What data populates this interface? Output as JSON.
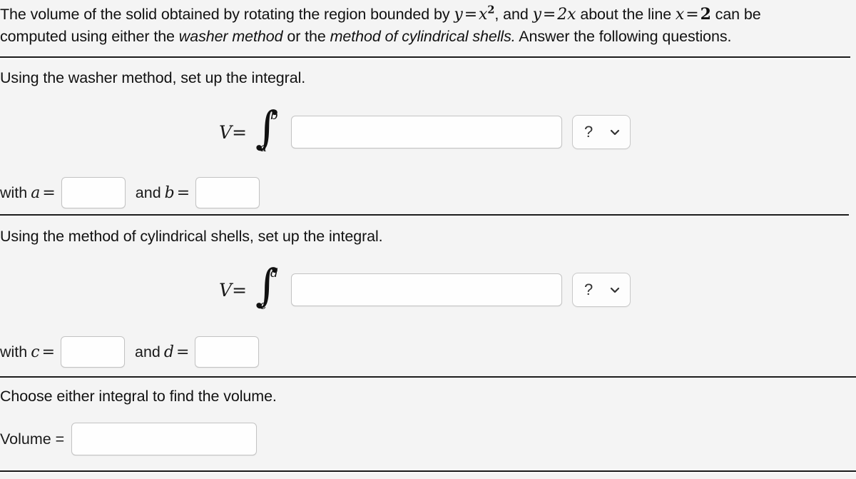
{
  "problem": {
    "line1_pre": "The volume of the solid obtained by rotating the region bounded by ",
    "eq1_lhs": "y",
    "eq1_rel": "=",
    "eq1_rhs_base": "x",
    "eq1_rhs_exp": "2",
    "line1_mid": ", and ",
    "eq2_lhs": "y",
    "eq2_rel": "=",
    "eq2_rhs": "2x",
    "line1_mid2": " about the line ",
    "eq3_lhs": "x",
    "eq3_rel": "=",
    "eq3_rhs": "2",
    "line1_post": " can be",
    "line2_pre": "computed using either the ",
    "method1": "washer method",
    "line2_mid": " or the ",
    "method2": "method of cylindrical shells.",
    "line2_post": " Answer the following questions."
  },
  "section_washer": {
    "heading": "Using the washer method, set up the integral.",
    "integral": {
      "v_label": "V",
      "equals": "=",
      "integral_sign": "∫",
      "upper_limit": "b",
      "lower_limit": "a",
      "integrand_value": "",
      "integrand_placeholder": ""
    },
    "dropdown": {
      "selected": "?",
      "icon": "chevron-down-icon"
    },
    "bounds": {
      "with_label": "with",
      "var1": "a",
      "eq1": "=",
      "value1": "",
      "and_label": "and",
      "var2": "b",
      "eq2": "=",
      "value2": ""
    }
  },
  "section_shells": {
    "heading": "Using the method of cylindrical shells, set up the integral.",
    "integral": {
      "v_label": "V",
      "equals": "=",
      "integral_sign": "∫",
      "upper_limit": "d",
      "lower_limit": "c",
      "integrand_value": "",
      "integrand_placeholder": ""
    },
    "dropdown": {
      "selected": "?",
      "icon": "chevron-down-icon"
    },
    "bounds": {
      "with_label": "with",
      "var1": "c",
      "eq1": "=",
      "value1": "",
      "and_label": "and",
      "var2": "d",
      "eq2": "=",
      "value2": ""
    }
  },
  "section_volume": {
    "heading": "Choose either integral to find the volume.",
    "label": "Volume =",
    "value": "",
    "placeholder": ""
  },
  "colors": {
    "page_background": "#f4f4f4",
    "rule": "#1b1b1b",
    "input_border": "#c3c3c3",
    "input_background": "#fefefe",
    "text": "#111111"
  }
}
